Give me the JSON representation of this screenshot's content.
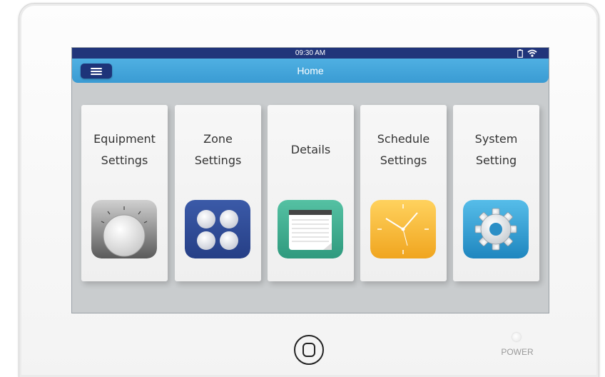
{
  "status_bar": {
    "time": "09:30  AM",
    "icons": [
      "battery-icon",
      "wifi-icon"
    ]
  },
  "nav_bar": {
    "menu_icon": "hamburger-menu-icon",
    "title": "Home"
  },
  "tiles": [
    {
      "label": "Equipment\nSettings",
      "icon": "dial-knob-icon",
      "color": "#6b6b6b"
    },
    {
      "label": "Zone\nSettings",
      "icon": "zones-grid-icon",
      "color": "#2f4c99"
    },
    {
      "label": "Details",
      "icon": "notepad-icon",
      "color": "#3fae92"
    },
    {
      "label": "Schedule\nSettings",
      "icon": "clock-icon",
      "color": "#f4b52a"
    },
    {
      "label": "System\nSetting",
      "icon": "gear-icon",
      "color": "#2d96cf"
    }
  ],
  "hardware": {
    "home_button_icon": "home-button-icon",
    "power_label": "POWER"
  },
  "colors": {
    "status_bar": "#21357a",
    "nav_bar": "#3ea3d8",
    "screen_background": "#c9ccce"
  }
}
